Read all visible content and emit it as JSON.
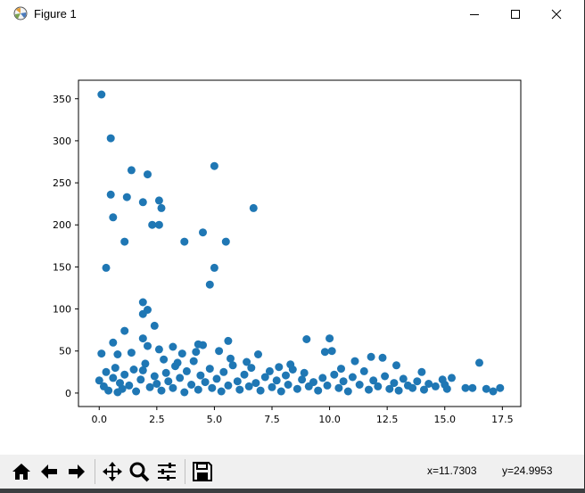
{
  "window": {
    "title": "Figure 1",
    "icons": {
      "app": "matplotlib-icon",
      "minimize": "minimize-icon",
      "maximize": "maximize-icon",
      "close": "close-icon"
    }
  },
  "toolbar": {
    "buttons": [
      {
        "name": "home-button",
        "icon": "home-icon"
      },
      {
        "name": "back-button",
        "icon": "arrow-left-icon"
      },
      {
        "name": "forward-button",
        "icon": "arrow-right-icon"
      },
      {
        "name": "pan-button",
        "icon": "move-icon"
      },
      {
        "name": "zoom-button",
        "icon": "magnifier-icon"
      },
      {
        "name": "configure-subplots-button",
        "icon": "sliders-icon"
      },
      {
        "name": "save-button",
        "icon": "floppy-disk-icon"
      }
    ],
    "x_readout": "x=11.7303",
    "y_readout": "y=24.9953"
  },
  "chart_data": {
    "type": "scatter",
    "title": "",
    "xlabel": "",
    "ylabel": "",
    "xlim": [
      -0.9,
      18.3
    ],
    "ylim": [
      -16,
      372
    ],
    "xticks": [
      0.0,
      2.5,
      5.0,
      7.5,
      10.0,
      12.5,
      15.0,
      17.5
    ],
    "xtick_labels": [
      "0.0",
      "2.5",
      "5.0",
      "7.5",
      "10.0",
      "12.5",
      "15.0",
      "17.5"
    ],
    "yticks": [
      0,
      50,
      100,
      150,
      200,
      250,
      300,
      350
    ],
    "ytick_labels": [
      "0",
      "50",
      "100",
      "150",
      "200",
      "250",
      "300",
      "350"
    ],
    "grid": false,
    "marker_color": "#1f77b4",
    "series": [
      {
        "points": [
          [
            0.1,
            355
          ],
          [
            0.5,
            303
          ],
          [
            1.4,
            265
          ],
          [
            2.1,
            260
          ],
          [
            5.0,
            270
          ],
          [
            0.5,
            236
          ],
          [
            1.2,
            233
          ],
          [
            1.9,
            227
          ],
          [
            2.6,
            229
          ],
          [
            2.7,
            220
          ],
          [
            6.7,
            220
          ],
          [
            0.6,
            209
          ],
          [
            2.3,
            200
          ],
          [
            2.6,
            200
          ],
          [
            4.5,
            191
          ],
          [
            1.1,
            180
          ],
          [
            3.7,
            180
          ],
          [
            5.5,
            180
          ],
          [
            0.3,
            149
          ],
          [
            5.0,
            149
          ],
          [
            4.8,
            129
          ],
          [
            1.9,
            108
          ],
          [
            2.1,
            99
          ],
          [
            1.9,
            94
          ],
          [
            2.4,
            80
          ],
          [
            1.1,
            74
          ],
          [
            9.0,
            64
          ],
          [
            10.0,
            65
          ],
          [
            1.9,
            65
          ],
          [
            5.6,
            62
          ],
          [
            0.6,
            60
          ],
          [
            4.3,
            58
          ],
          [
            2.1,
            56
          ],
          [
            3.2,
            55
          ],
          [
            4.5,
            57
          ],
          [
            0.1,
            47
          ],
          [
            0.8,
            46
          ],
          [
            1.4,
            48
          ],
          [
            2.6,
            52
          ],
          [
            3.6,
            47
          ],
          [
            4.2,
            49
          ],
          [
            5.2,
            50
          ],
          [
            6.9,
            46
          ],
          [
            9.8,
            49
          ],
          [
            10.1,
            50
          ],
          [
            11.1,
            38
          ],
          [
            11.8,
            43
          ],
          [
            12.3,
            42
          ],
          [
            14.0,
            25
          ],
          [
            16.5,
            36
          ],
          [
            0.0,
            15
          ],
          [
            0.2,
            8
          ],
          [
            0.3,
            25
          ],
          [
            0.4,
            3
          ],
          [
            0.6,
            18
          ],
          [
            0.7,
            30
          ],
          [
            0.9,
            12
          ],
          [
            1.0,
            5
          ],
          [
            1.1,
            22
          ],
          [
            1.3,
            9
          ],
          [
            1.5,
            28
          ],
          [
            1.6,
            2
          ],
          [
            1.8,
            16
          ],
          [
            2.0,
            35
          ],
          [
            2.2,
            7
          ],
          [
            2.4,
            20
          ],
          [
            2.5,
            11
          ],
          [
            2.7,
            3
          ],
          [
            2.9,
            24
          ],
          [
            3.0,
            14
          ],
          [
            3.2,
            6
          ],
          [
            3.3,
            32
          ],
          [
            3.5,
            18
          ],
          [
            3.7,
            1
          ],
          [
            3.8,
            26
          ],
          [
            4.0,
            10
          ],
          [
            4.1,
            38
          ],
          [
            4.3,
            4
          ],
          [
            4.4,
            21
          ],
          [
            4.6,
            13
          ],
          [
            4.8,
            29
          ],
          [
            4.9,
            6
          ],
          [
            5.1,
            17
          ],
          [
            5.3,
            2
          ],
          [
            5.4,
            25
          ],
          [
            5.6,
            9
          ],
          [
            5.8,
            33
          ],
          [
            6.0,
            14
          ],
          [
            6.1,
            4
          ],
          [
            6.3,
            22
          ],
          [
            6.5,
            8
          ],
          [
            6.6,
            30
          ],
          [
            6.8,
            12
          ],
          [
            7.0,
            3
          ],
          [
            7.2,
            19
          ],
          [
            7.4,
            26
          ],
          [
            7.5,
            7
          ],
          [
            7.7,
            15
          ],
          [
            7.9,
            2
          ],
          [
            8.1,
            21
          ],
          [
            8.2,
            10
          ],
          [
            8.4,
            28
          ],
          [
            8.6,
            5
          ],
          [
            8.8,
            16
          ],
          [
            8.9,
            24
          ],
          [
            9.1,
            8
          ],
          [
            9.3,
            13
          ],
          [
            9.5,
            3
          ],
          [
            9.7,
            18
          ],
          [
            9.9,
            9
          ],
          [
            10.2,
            22
          ],
          [
            10.4,
            6
          ],
          [
            10.6,
            14
          ],
          [
            10.8,
            2
          ],
          [
            11.0,
            19
          ],
          [
            11.3,
            10
          ],
          [
            11.5,
            26
          ],
          [
            11.7,
            4
          ],
          [
            11.9,
            15
          ],
          [
            12.1,
            8
          ],
          [
            12.4,
            20
          ],
          [
            12.6,
            5
          ],
          [
            12.8,
            12
          ],
          [
            13.0,
            3
          ],
          [
            13.2,
            17
          ],
          [
            13.4,
            9
          ],
          [
            13.6,
            6
          ],
          [
            13.8,
            14
          ],
          [
            14.1,
            4
          ],
          [
            14.3,
            11
          ],
          [
            14.6,
            8
          ],
          [
            14.9,
            16
          ],
          [
            15.1,
            5
          ],
          [
            15.3,
            18
          ],
          [
            15.9,
            6
          ],
          [
            16.2,
            6
          ],
          [
            16.8,
            5
          ],
          [
            17.1,
            2
          ],
          [
            17.4,
            6
          ],
          [
            0.8,
            1
          ],
          [
            1.9,
            27
          ],
          [
            2.8,
            40
          ],
          [
            3.4,
            36
          ],
          [
            5.7,
            41
          ],
          [
            6.4,
            37
          ],
          [
            7.8,
            31
          ],
          [
            8.3,
            34
          ],
          [
            10.5,
            29
          ],
          [
            12.9,
            33
          ],
          [
            15.0,
            10
          ]
        ]
      }
    ]
  }
}
